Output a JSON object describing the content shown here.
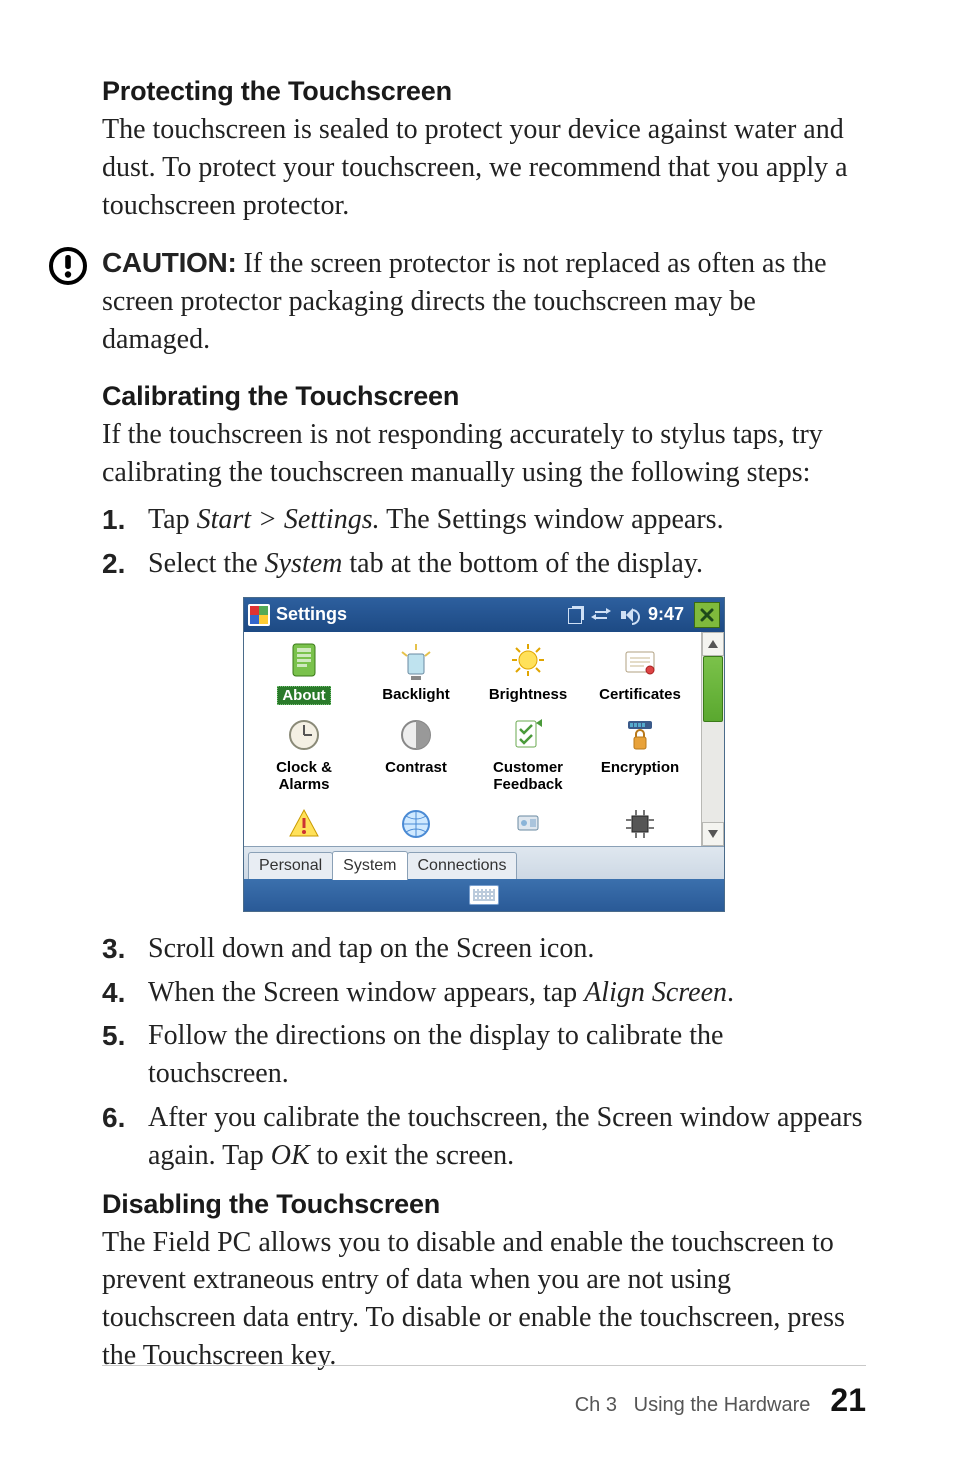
{
  "section_protect": {
    "heading": "Protecting the Touchscreen",
    "body": "The touchscreen is sealed to protect your device against water and dust. To protect your touchscreen, we recommend that you apply a touchscreen protector."
  },
  "caution": {
    "label": "CAUTION:",
    "text": "  If the screen protector is not replaced as often as the screen protector packaging directs the touchscreen may be damaged."
  },
  "section_calibrate": {
    "heading": "Calibrating the Touchscreen",
    "body": "If the touchscreen is not responding accurately to stylus taps, try calibrating the touchscreen manually using the following steps:"
  },
  "steps_a": [
    {
      "num": "1.",
      "pre": "Tap ",
      "em": "Start > Settings.",
      "post": " The Settings window appears."
    },
    {
      "num": "2.",
      "pre": "Select the ",
      "em": "System",
      "post": " tab at the bottom of the display."
    }
  ],
  "screenshot": {
    "title": "Settings",
    "clock": "9:47",
    "close": "X",
    "apps": {
      "about": "About",
      "backlight": "Backlight",
      "brightness": "Brightness",
      "certificates": "Certificates",
      "clock_alarms_l1": "Clock &",
      "clock_alarms_l2": "Alarms",
      "contrast": "Contrast",
      "customer_l1": "Customer",
      "customer_l2": "Feedback",
      "encryption": "Encryption"
    },
    "tabs": {
      "personal": "Personal",
      "system": "System",
      "connections": "Connections"
    }
  },
  "steps_b": [
    {
      "num": "3.",
      "pre": "Scroll down and tap on the Screen icon.",
      "em": "",
      "post": ""
    },
    {
      "num": "4.",
      "pre": "When the Screen window appears, tap ",
      "em": "Align Screen",
      "post": "."
    },
    {
      "num": "5.",
      "pre": "Follow the directions on the display to calibrate the touchscreen.",
      "em": "",
      "post": ""
    },
    {
      "num": "6.",
      "pre": "After you calibrate the touchscreen, the Screen window appears again. Tap ",
      "em": "OK",
      "post": " to exit the screen."
    }
  ],
  "section_disable": {
    "heading": "Disabling the Touchscreen",
    "body": "The Field PC allows you to disable and enable the touchscreen to prevent extraneous entry of data when you are not using touchscreen data entry. To disable or enable the touchscreen, press the Touchscreen key."
  },
  "footer": {
    "chapter": "Ch 3",
    "title": "Using the Hardware",
    "page": "21"
  }
}
